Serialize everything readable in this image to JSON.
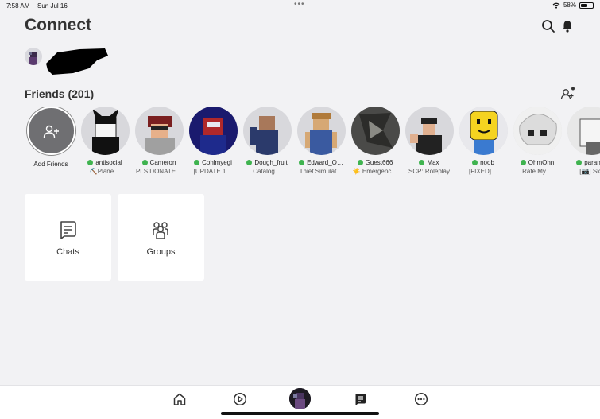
{
  "status_bar": {
    "time": "7:58 AM",
    "date": "Sun Jul 16",
    "battery_text": "58%",
    "battery_level": 0.58,
    "icons": [
      "wifi-icon",
      "battery-icon"
    ]
  },
  "header": {
    "title": "Connect",
    "icons": [
      "search-icon",
      "bell-icon"
    ]
  },
  "friends": {
    "title": "Friends (201)",
    "add_label": "Add Friends",
    "list": [
      {
        "name": "antisocial",
        "status": "⛏️Plane…",
        "online": true,
        "avatar_color": "#d8d8dc"
      },
      {
        "name": "Cameron",
        "status": "PLS DONATE…",
        "online": true,
        "avatar_color": "#d8d8dc"
      },
      {
        "name": "Cohlmyegi",
        "status": "[UPDATE 1…",
        "online": true,
        "avatar_color": "#d8d8dc"
      },
      {
        "name": "Dough_fruit",
        "status": "Catalog…",
        "online": true,
        "avatar_color": "#d8d8dc"
      },
      {
        "name": "Edward_O…",
        "status": "Thief Simulat…",
        "online": true,
        "avatar_color": "#d8d8dc"
      },
      {
        "name": "Guest666",
        "status": "☀️ Emergenc…",
        "online": true,
        "avatar_color": "#d8d8dc"
      },
      {
        "name": "Max",
        "status": "SCP: Roleplay",
        "online": true,
        "avatar_color": "#d8d8dc"
      },
      {
        "name": "noob",
        "status": "[FIXED]…",
        "online": true,
        "avatar_color": "#d8d8dc"
      },
      {
        "name": "OhmOhn",
        "status": "Rate My…",
        "online": true,
        "avatar_color": "#d8d8dc"
      },
      {
        "name": "paranor",
        "status": "[📷] Skil",
        "online": true,
        "avatar_color": "#d8d8dc"
      }
    ]
  },
  "tiles": {
    "chats_label": "Chats",
    "groups_label": "Groups"
  },
  "bottom_nav": {
    "items": [
      "home-icon",
      "play-icon",
      "avatar",
      "chat-icon",
      "more-icon"
    ]
  },
  "colors": {
    "background": "#f2f2f4",
    "online": "#3fb34f",
    "tile": "#ffffff"
  }
}
